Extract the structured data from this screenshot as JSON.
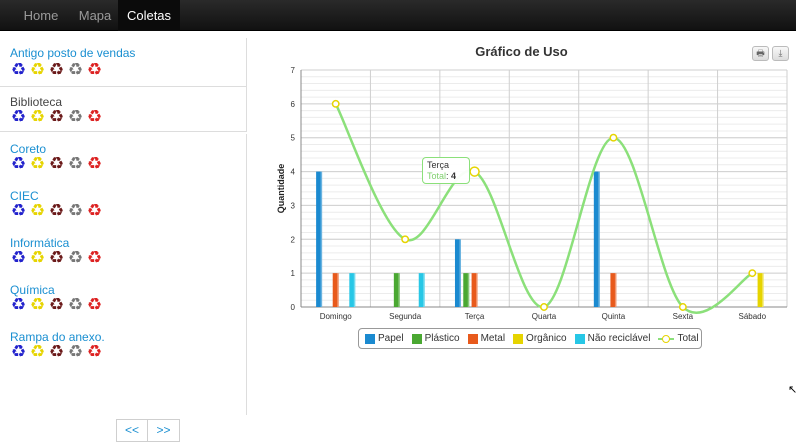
{
  "nav": {
    "items": [
      {
        "label": "Home"
      },
      {
        "label": "Mapa"
      },
      {
        "label": "Coletas"
      }
    ]
  },
  "sidebar": {
    "locations": [
      {
        "name": "Antigo posto de vendas"
      },
      {
        "name": "Biblioteca"
      },
      {
        "name": "Coreto"
      },
      {
        "name": "CIEC"
      },
      {
        "name": "Informática"
      },
      {
        "name": "Química"
      },
      {
        "name": "Rampa do anexo."
      }
    ],
    "recycle_icon_colors": [
      "#2222cc",
      "#e6d400",
      "#6b1a1a",
      "#777777",
      "#dd2222"
    ],
    "recycle_glyph": "♻"
  },
  "pager": {
    "prev": "<<",
    "next": ">>"
  },
  "toolbar": {
    "print_icon": "🖶",
    "export_icon": "⤓"
  },
  "tooltip": {
    "category": "Terça",
    "label": "Total",
    "value": "4"
  },
  "colors": {
    "Papel": "#1b8ad0",
    "Plástico": "#4aa832",
    "Metal": "#e85a1c",
    "Orgânico": "#e6d400",
    "Não reciclável": "#27c7e6",
    "Total": "#8be07a",
    "TotalMarker": "#e6d400"
  },
  "chart_data": {
    "type": "bar",
    "title": "Gráfico de Uso",
    "xlabel": "",
    "ylabel": "Quantidade",
    "ylim": [
      0,
      7
    ],
    "yticks": [
      0,
      1,
      2,
      3,
      4,
      5,
      6,
      7
    ],
    "categories": [
      "Domingo",
      "Segunda",
      "Terça",
      "Quarta",
      "Quinta",
      "Sexta",
      "Sábado"
    ],
    "series": [
      {
        "name": "Papel",
        "values": [
          4,
          0,
          2,
          0,
          4,
          0,
          0
        ]
      },
      {
        "name": "Plástico",
        "values": [
          0,
          1,
          1,
          0,
          0,
          0,
          0
        ]
      },
      {
        "name": "Metal",
        "values": [
          1,
          0,
          1,
          0,
          1,
          0,
          0
        ]
      },
      {
        "name": "Orgânico",
        "values": [
          0,
          0,
          0,
          0,
          0,
          0,
          1
        ]
      },
      {
        "name": "Não reciclável",
        "values": [
          1,
          1,
          0,
          0,
          0,
          0,
          0
        ]
      }
    ],
    "line_series": {
      "name": "Total",
      "values": [
        6,
        2,
        4,
        0,
        5,
        0,
        1
      ]
    },
    "grid": true,
    "legend": "bottom-center"
  }
}
